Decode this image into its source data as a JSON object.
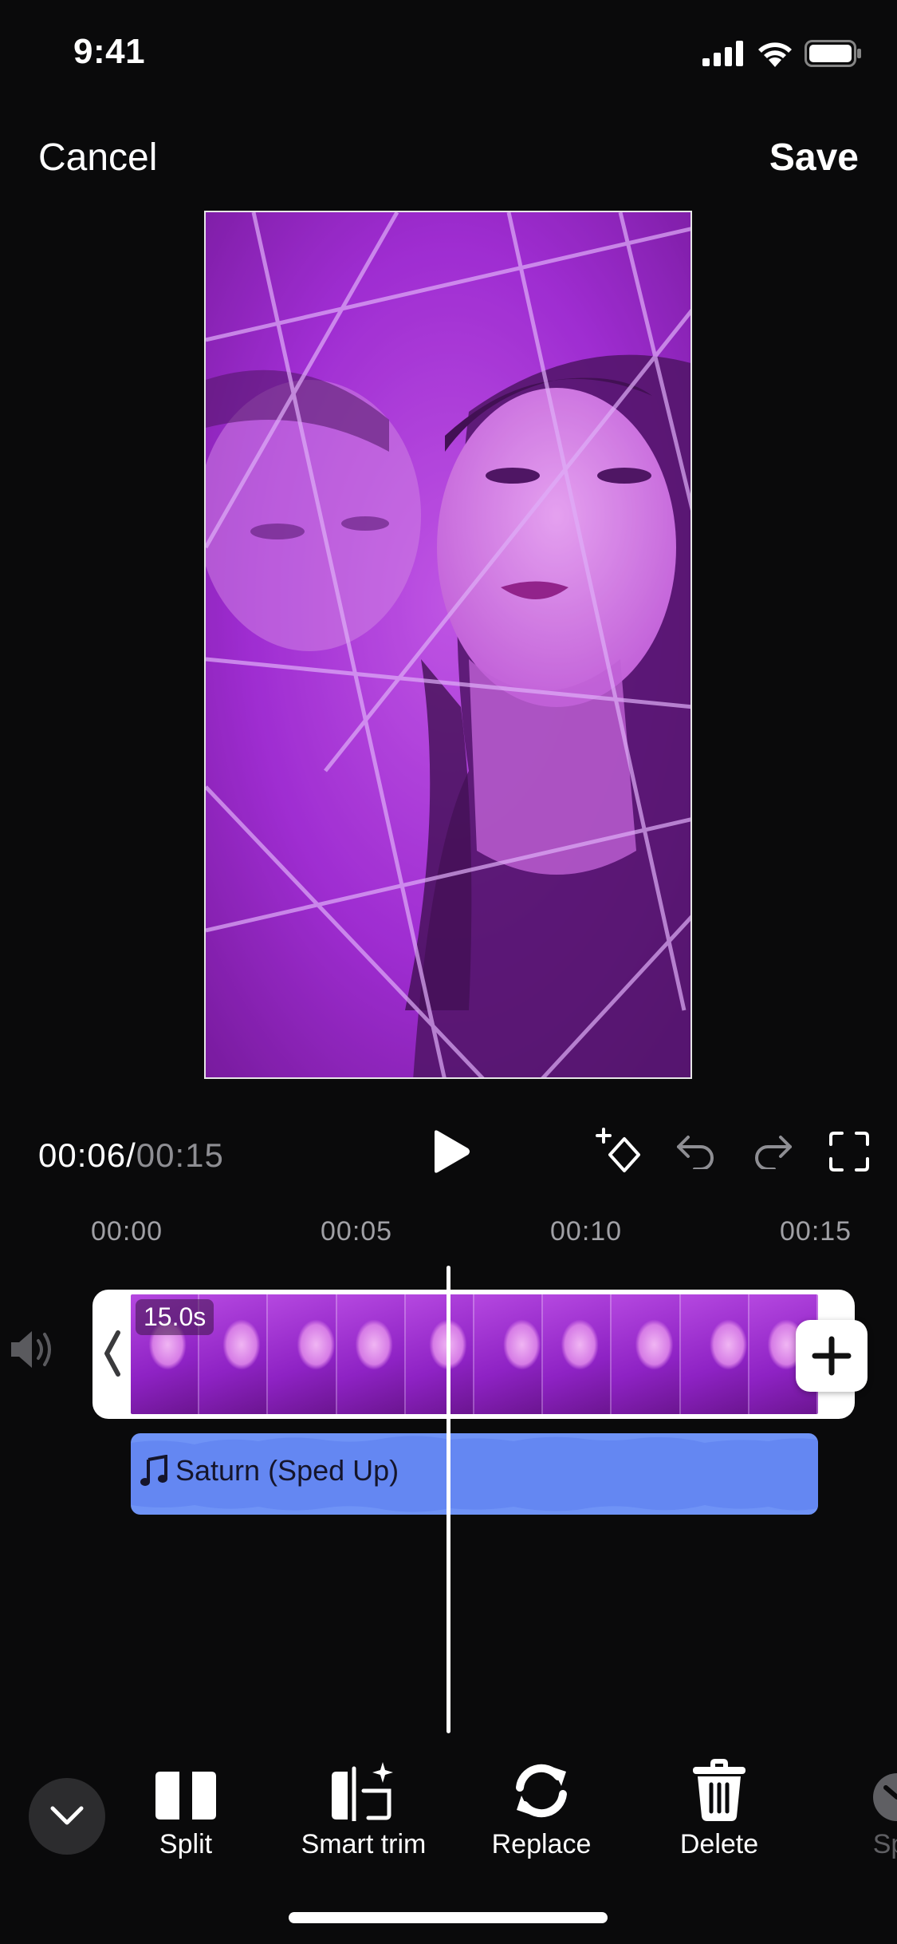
{
  "status_bar": {
    "time": "9:41"
  },
  "header": {
    "cancel_label": "Cancel",
    "save_label": "Save"
  },
  "player": {
    "current_time": "00:06",
    "separator": "/",
    "total_time": "00:15"
  },
  "ruler": {
    "ticks": [
      "00:00",
      "00:05",
      "00:10",
      "00:15"
    ]
  },
  "timeline": {
    "clip_duration": "15.0s",
    "audio_track": "Saturn (Sped Up)",
    "playhead_fraction": 0.4
  },
  "toolbar": {
    "tools": [
      {
        "label": "Split",
        "icon": "split-icon"
      },
      {
        "label": "Smart trim",
        "icon": "smart-trim-icon"
      },
      {
        "label": "Replace",
        "icon": "replace-icon"
      },
      {
        "label": "Delete",
        "icon": "trash-icon"
      },
      {
        "label": "Spe",
        "icon": "speed-icon"
      }
    ]
  },
  "colors": {
    "background": "#0a0a0b",
    "audio_track": "#6f93f6",
    "clip_tint": "#b33ad8"
  }
}
